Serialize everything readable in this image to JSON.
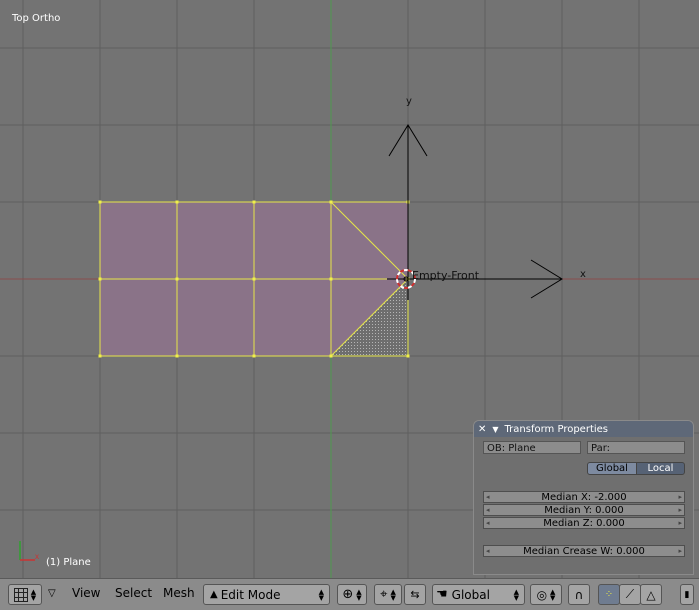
{
  "viewport": {
    "view_label": "Top Ortho",
    "object_label": "(1) Plane",
    "empty_label": "Empty-Front",
    "axis_y": "y",
    "axis_x": "x",
    "colors": {
      "background": "#737373",
      "grid": "#5f5f5f",
      "face": "#8a7388",
      "edge": "#e5e548",
      "vertex": "#f0f04a"
    }
  },
  "transform_panel": {
    "title": "Transform Properties",
    "ob_field": "OB: Plane",
    "par_field": "Par:",
    "global_label": "Global",
    "local_label": "Local",
    "median_x": "Median X: -2.000",
    "median_y": "Median Y: 0.000",
    "median_z": "Median Z: 0.000",
    "median_crease": "Median Crease W: 0.000"
  },
  "toolbar": {
    "view": "View",
    "select": "Select",
    "mesh": "Mesh",
    "mode": "Edit Mode",
    "orientation": "Global"
  }
}
